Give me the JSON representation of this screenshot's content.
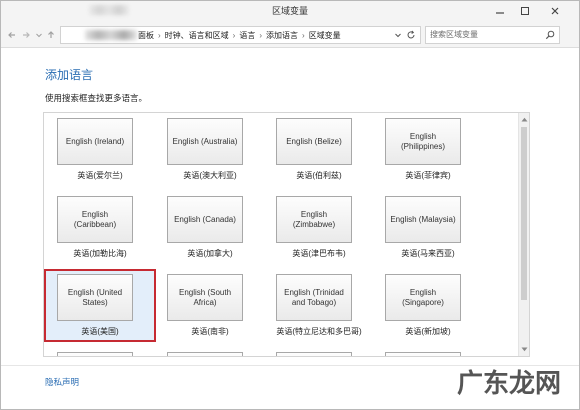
{
  "window": {
    "title": "区域变量"
  },
  "address_bar": {
    "breadcrumb": [
      "面板",
      "时钟、语言和区域",
      "语言",
      "添加语言",
      "区域变量"
    ],
    "separator": "›",
    "search_placeholder": "搜索区域变量"
  },
  "main": {
    "heading": "添加语言",
    "subtitle": "使用搜索框查找更多语言。",
    "languages": [
      {
        "tile": "English (Ireland)",
        "label": "英语(爱尔兰)"
      },
      {
        "tile": "English (Australia)",
        "label": "英语(澳大利亚)"
      },
      {
        "tile": "English (Belize)",
        "label": "英语(伯利兹)"
      },
      {
        "tile": "English (Philippines)",
        "label": "英语(菲律宾)"
      },
      {
        "tile": "English (Caribbean)",
        "label": "英语(加勒比海)"
      },
      {
        "tile": "English (Canada)",
        "label": "英语(加拿大)"
      },
      {
        "tile": "English (Zimbabwe)",
        "label": "英语(津巴布韦)"
      },
      {
        "tile": "English (Malaysia)",
        "label": "英语(马来西亚)"
      },
      {
        "tile": "English (United States)",
        "label": "英语(美国)",
        "selected": true
      },
      {
        "tile": "English (South Africa)",
        "label": "英语(南非)"
      },
      {
        "tile": "English (Trinidad and Tobago)",
        "label": "英语(特立尼达和多巴哥)"
      },
      {
        "tile": "English (Singapore)",
        "label": "英语(新加坡)"
      }
    ]
  },
  "footer": {
    "privacy_link": "隐私声明"
  },
  "watermark": "广东龙网",
  "icons": [
    "minimize-icon",
    "maximize-icon",
    "close-icon",
    "back-arrow-icon",
    "forward-arrow-icon",
    "recent-pages-chevron-icon",
    "up-arrow-icon",
    "address-dropdown-chevron-icon",
    "refresh-icon",
    "search-icon",
    "scroll-up-arrow-icon",
    "scroll-down-arrow-icon"
  ],
  "colors": {
    "link": "#2a6db3",
    "selection_border": "#c62a32",
    "selection_fill": "#e3eefa",
    "tile_border": "#a8a8a8"
  }
}
